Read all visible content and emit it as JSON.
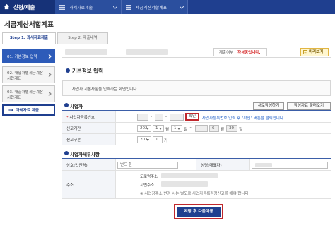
{
  "topnav": {
    "home_label": "신청/제출",
    "crumbs": [
      "과세자료제출",
      "세금계산서합계표"
    ]
  },
  "page": {
    "title": "세금계산서합계표"
  },
  "steps": [
    "Step 1. 과세자료제출",
    "Step 2. 제출내역"
  ],
  "sidebar": {
    "items": [
      {
        "label": "01. 기본정보 입력"
      },
      {
        "label": "02. 매입처별세금계산서합계표"
      },
      {
        "label": "03. 매출처별세금계산서합계표"
      },
      {
        "label": "04. 과세자료 제출"
      }
    ]
  },
  "status": {
    "label": "제출여부",
    "value": "작성중입니다."
  },
  "preview_label": "미리보기",
  "section": {
    "basic_title": "기본정보 입력",
    "notice": "사업자 기본사항을 입력하는 화면입니다."
  },
  "buttons": {
    "new_write": "새로작성하기",
    "load_written": "작성자료 불러오기"
  },
  "business": {
    "title": "사업자",
    "reg_no_label": "사업자등록번호",
    "confirm_label": "확인",
    "reg_hint": "사업자등록번호 입력 후 \"확인\" 버튼을 클릭합니다.",
    "period_label": "신고기간",
    "period_year": "202",
    "period_start_month": "1",
    "period_start_day": "1",
    "period_end_month": "6",
    "period_end_day": "30",
    "unit_month": "월",
    "unit_day": "일",
    "separator": "~",
    "type_label": "신고구분",
    "type_year": "202",
    "type_value": "1",
    "type_unit": "기"
  },
  "company": {
    "title": "사업자세부사항",
    "name_label": "상호(법인명)",
    "name_value": "번드 환",
    "rep_label": "성명(대표자)",
    "address_label": "주소",
    "road_label": "도로명주소",
    "lot_label": "지번주소",
    "address_hint": "※ 사업장주소 변경 시는 별도로 사업자등록정정신고를 해야 합니다."
  },
  "save_button": "저장 후 다음이동",
  "colors": {
    "nav": "#1f3f8f",
    "highlight": "#c0282d",
    "status_red": "#d32020"
  }
}
